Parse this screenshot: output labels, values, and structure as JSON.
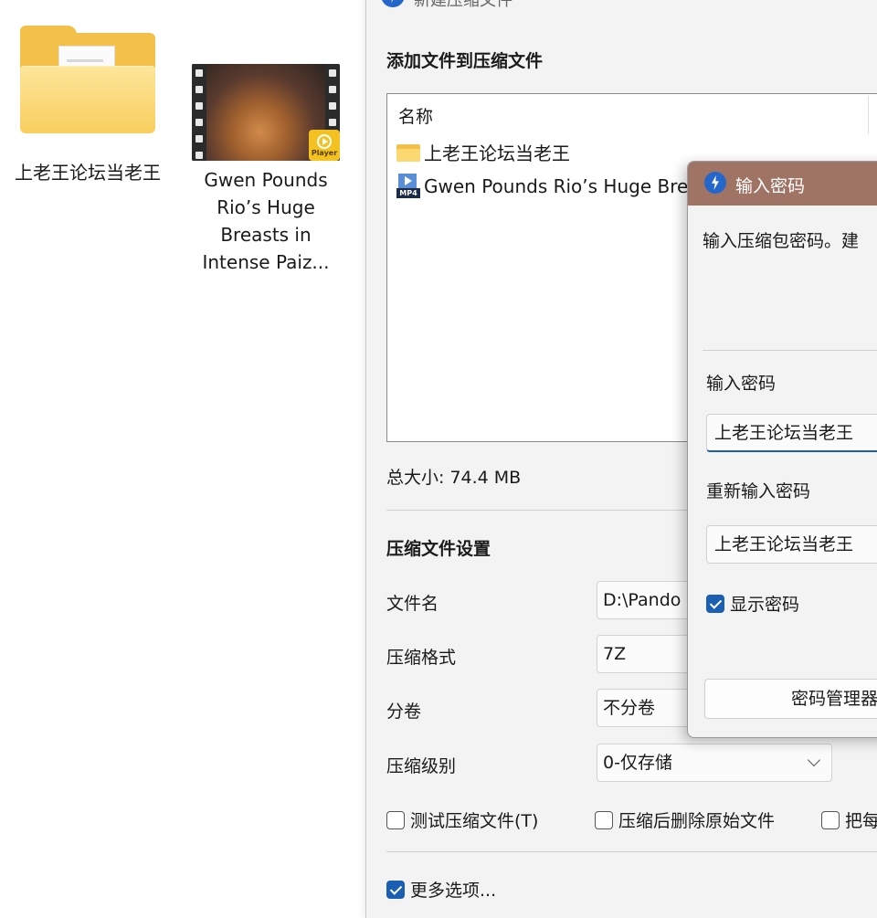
{
  "desktop": {
    "folder": {
      "label": "上老王论坛当老王"
    },
    "video": {
      "label": "Gwen Pounds Rio’s Huge Breasts in Intense Paiz...",
      "badge": "Player"
    }
  },
  "main_dialog": {
    "title": "新建压缩文件",
    "add_section_heading": "添加文件到压缩文件",
    "file_list": {
      "column_header": "名称",
      "rows": [
        {
          "name": "上老王论坛当老王",
          "icon": "folder-icon"
        },
        {
          "name": "Gwen Pounds Rio’s Huge Bre",
          "icon": "mp4-icon",
          "icon_text": "MP4"
        }
      ]
    },
    "total_size": "总大小: 74.4 MB",
    "settings_heading": "压缩文件设置",
    "filename": {
      "label": "文件名",
      "value": "D:\\Pando"
    },
    "format": {
      "label": "压缩格式",
      "value": "7Z"
    },
    "split": {
      "label": "分卷",
      "value": "不分卷"
    },
    "level": {
      "label": "压缩级别",
      "value": "0-仅存储"
    },
    "options": {
      "test_archive": {
        "label": "测试压缩文件(T)",
        "checked": false
      },
      "delete_after": {
        "label": "压缩后删除原始文件",
        "checked": false
      },
      "each_to_separate": {
        "label": "把每",
        "checked": false
      }
    },
    "more_options": {
      "label": "更多选项...",
      "checked": true
    }
  },
  "password_dialog": {
    "title": "输入密码",
    "description": "输入压缩包密码。建",
    "password_label": "输入密码",
    "password_value": "上老王论坛当老王",
    "confirm_label": "重新输入密码",
    "confirm_value": "上老王论坛当老王",
    "show_password": {
      "label": "显示密码",
      "checked": true
    },
    "manager_button": "密码管理器"
  },
  "colors": {
    "pw_titlebar": "#a07465",
    "accent": "#1a5fb4",
    "folder": "#f3c04a"
  }
}
